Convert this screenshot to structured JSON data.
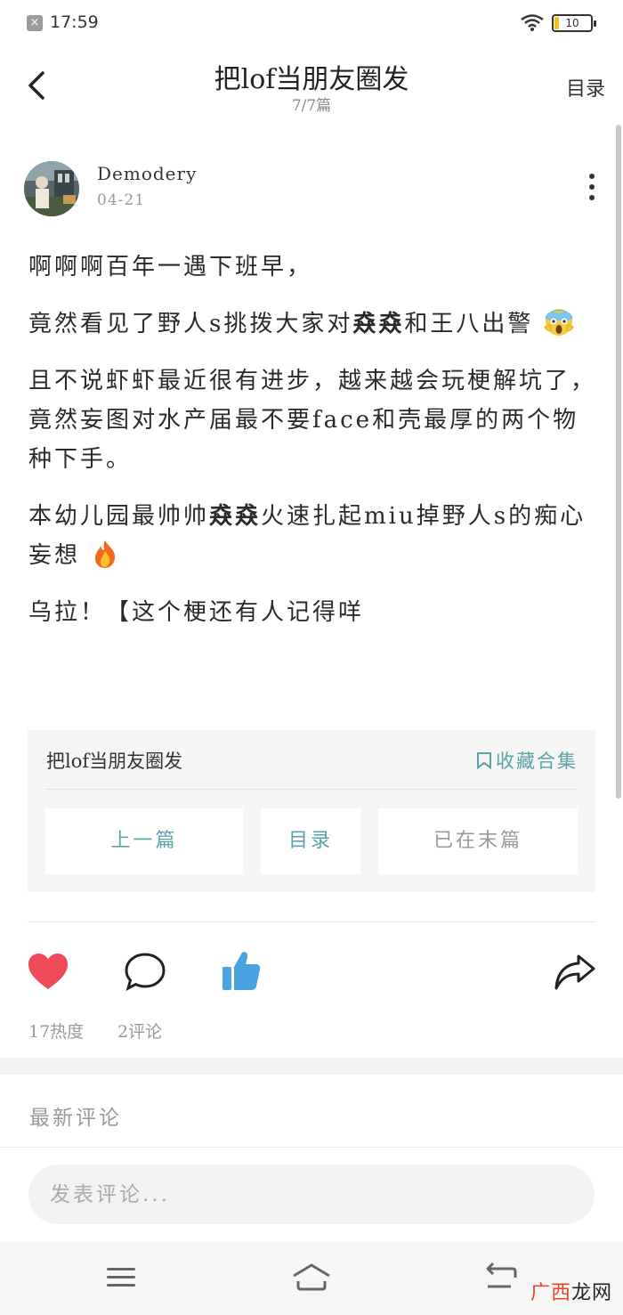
{
  "status_bar": {
    "time": "17:59",
    "battery": "10",
    "notify_glyph": "×"
  },
  "header": {
    "title": "把lof当朋友圈发",
    "subtitle": "7/7篇",
    "toc_label": "目录"
  },
  "author": {
    "name": "Demodery",
    "date": "04-21"
  },
  "article": {
    "p1": "啊啊啊百年一遇下班早，",
    "p2_a": "竟然看见了野人s挑拨大家对",
    "p2_bold": "猋猋",
    "p2_b": "和王八出警",
    "p2_emoji": "scream-emoji",
    "p3": "且不说虾虾最近很有进步，越来越会玩梗解坑了，竟然妄图对水产届最不要face和壳最厚的两个物种下手。",
    "p4_a": "本幼儿园最帅帅",
    "p4_bold": "猋猋",
    "p4_b": "火速扎起miu掉野人s的痴心妄想",
    "p4_emoji": "fire-emoji",
    "p5": "乌拉！【这个梗还有人记得咩"
  },
  "collection": {
    "title": "把lof当朋友圈发",
    "favorite_label": "收藏合集",
    "prev_label": "上一篇",
    "toc_label": "目录",
    "end_label": "已在末篇"
  },
  "actions": {
    "heat_label": "17热度",
    "comments_label": "2评论"
  },
  "comments": {
    "section_label": "最新评论",
    "input_placeholder": "发表评论..."
  },
  "watermark": {
    "part1": "广西",
    "part2": "龙网"
  },
  "colors": {
    "accent": "#5aa3a8",
    "heart": "#ef4a5a",
    "thumb": "#4aa3e0"
  }
}
